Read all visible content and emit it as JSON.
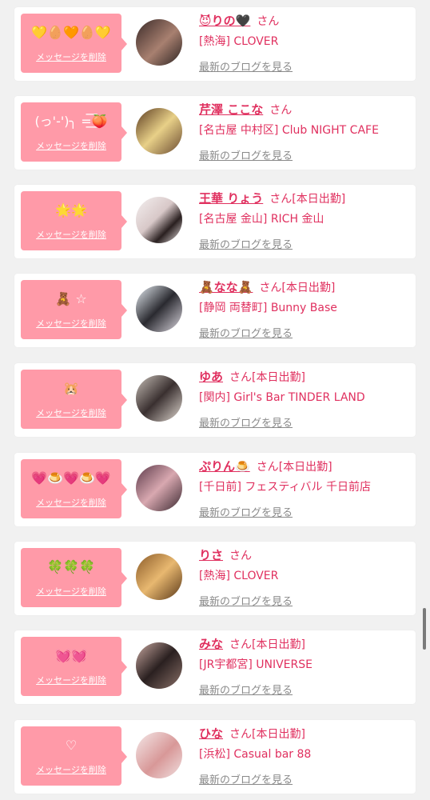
{
  "delete_label": "メッセージを削除",
  "blog_label": "最新のブログを見る",
  "san_label": "さん",
  "colors": {
    "accent": "#e0305f",
    "bubble": "#ff9aa8",
    "background": "#f1f1f1"
  },
  "items": [
    {
      "message": "💛🥚🧡🥚💛",
      "name": "😈りの🖤",
      "status": "",
      "shop": "[熱海] CLOVER",
      "avatar": "profile-photo",
      "avatar_bg": "linear-gradient(135deg,#3a2a28,#a88070 55%,#2b2220)"
    },
    {
      "message": "(っ'-')╮ =͟͟͞͞🍑",
      "name": "芹澤 ここな",
      "status": "",
      "shop": "[名古屋 中村区] Club NIGHT CAFE",
      "avatar": "profile-photo",
      "avatar_bg": "linear-gradient(135deg,#5a3a20,#e8d088 50%,#6a4a30)"
    },
    {
      "message": "🌟🌟",
      "name": "王華 りょう",
      "status": "[本日出勤]",
      "shop": "[名古屋 金山] RICH 金山",
      "avatar": "profile-photo",
      "avatar_bg": "linear-gradient(135deg,#f4f0f0,#d8c8c8 45%,#2a2020 70%,#f0e8e8)"
    },
    {
      "message": "🧸 ☆",
      "name": "🧸なな🧸",
      "status": "[本日出勤]",
      "shop": "[静岡 両替町] Bunny Base",
      "avatar": "profile-photo",
      "avatar_bg": "linear-gradient(135deg,#e8eef4,#2a2a30 50%,#dcd8e0)"
    },
    {
      "message": "🐹",
      "name": "ゆあ",
      "status": "[本日出勤]",
      "shop": "[関内] Girl's Bar TINDER LAND",
      "avatar": "profile-photo",
      "avatar_bg": "linear-gradient(135deg,#c8c0b8,#3a3030 50%,#e0d8d0)"
    },
    {
      "message": "💗🍮💗🍮💗",
      "name": "ぷりん🍮",
      "status": "[本日出勤]",
      "shop": "[千日前] フェスティバル 千日前店",
      "avatar": "profile-photo",
      "avatar_bg": "linear-gradient(135deg,#5a3848,#d8a8b0 50%,#3a2830)"
    },
    {
      "message": "🍀🍀🍀",
      "name": "りさ",
      "status": "",
      "shop": "[熱海] CLOVER",
      "avatar": "profile-photo",
      "avatar_bg": "linear-gradient(135deg,#8a5a28,#e8b870 50%,#5a3818)"
    },
    {
      "message": "💓💓",
      "name": "みな",
      "status": "[本日出勤]",
      "shop": "[JR宇都宮] UNIVERSE",
      "avatar": "profile-photo",
      "avatar_bg": "linear-gradient(135deg,#c8a8a0,#2a2020 50%,#8a7068)"
    },
    {
      "message": "♡",
      "name": "ひな",
      "status": "[本日出勤]",
      "shop": "[浜松] Casual bar 88",
      "avatar": "profile-photo",
      "avatar_bg": "linear-gradient(135deg,#f4e8e8,#d89898 55%,#f0e0e0)"
    }
  ]
}
